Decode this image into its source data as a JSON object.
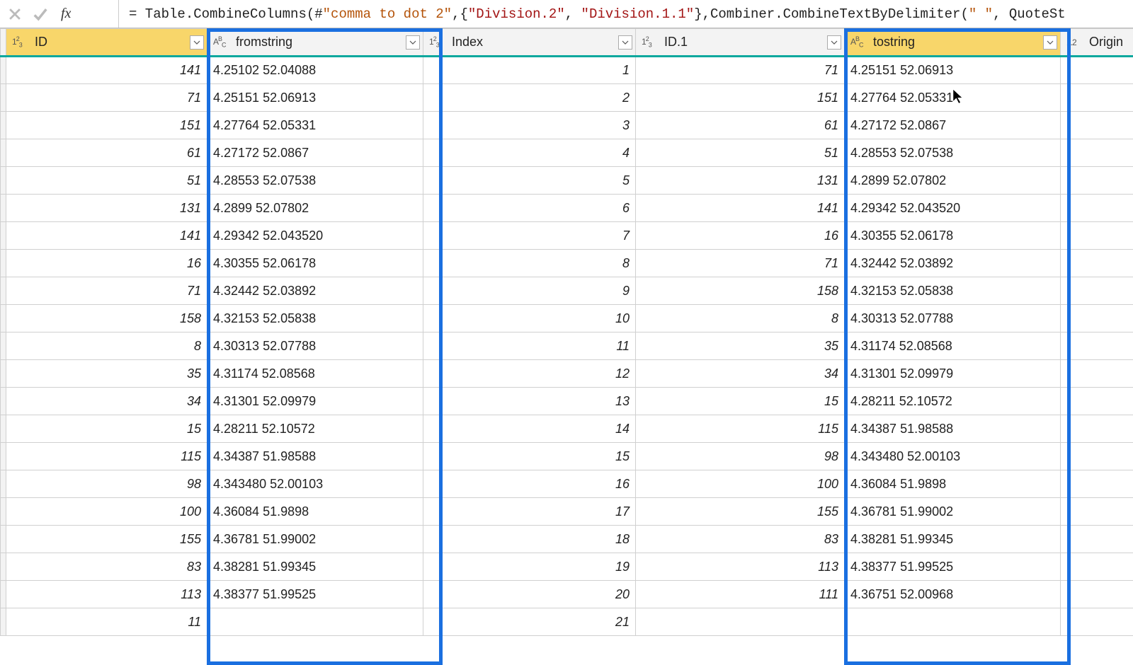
{
  "formula": {
    "prefix": "= Table.CombineColumns(#",
    "step_name": "\"comma to dot 2\"",
    "mid1": ",{",
    "col1": "\"Division.2\"",
    "sep": ", ",
    "col2": "\"Division.1.1\"",
    "mid2": "},Combiner.CombineTextByDelimiter(",
    "delim": "\" \"",
    "tail": ", QuoteSt"
  },
  "fx_label": "fx",
  "columns": {
    "id": {
      "label": "ID",
      "type": "123"
    },
    "from": {
      "label": "fromstring",
      "type": "ABC"
    },
    "index": {
      "label": "Index",
      "type": "123"
    },
    "id1": {
      "label": "ID.1",
      "type": "123"
    },
    "to": {
      "label": "tostring",
      "type": "ABC"
    },
    "origin": {
      "label": "Origin",
      "type": "1.2"
    }
  },
  "rows": [
    {
      "id": "141",
      "from": "4.25102 52.04088",
      "index": "1",
      "id1": "71",
      "to": "4.25151 52.06913"
    },
    {
      "id": "71",
      "from": "4.25151 52.06913",
      "index": "2",
      "id1": "151",
      "to": "4.27764 52.05331"
    },
    {
      "id": "151",
      "from": "4.27764 52.05331",
      "index": "3",
      "id1": "61",
      "to": "4.27172 52.0867"
    },
    {
      "id": "61",
      "from": "4.27172 52.0867",
      "index": "4",
      "id1": "51",
      "to": "4.28553 52.07538"
    },
    {
      "id": "51",
      "from": "4.28553 52.07538",
      "index": "5",
      "id1": "131",
      "to": "4.2899 52.07802"
    },
    {
      "id": "131",
      "from": "4.2899 52.07802",
      "index": "6",
      "id1": "141",
      "to": "4.29342 52.043520"
    },
    {
      "id": "141",
      "from": "4.29342 52.043520",
      "index": "7",
      "id1": "16",
      "to": "4.30355 52.06178"
    },
    {
      "id": "16",
      "from": "4.30355 52.06178",
      "index": "8",
      "id1": "71",
      "to": "4.32442 52.03892"
    },
    {
      "id": "71",
      "from": "4.32442 52.03892",
      "index": "9",
      "id1": "158",
      "to": "4.32153 52.05838"
    },
    {
      "id": "158",
      "from": "4.32153 52.05838",
      "index": "10",
      "id1": "8",
      "to": "4.30313 52.07788"
    },
    {
      "id": "8",
      "from": "4.30313 52.07788",
      "index": "11",
      "id1": "35",
      "to": "4.31174 52.08568"
    },
    {
      "id": "35",
      "from": "4.31174 52.08568",
      "index": "12",
      "id1": "34",
      "to": "4.31301 52.09979"
    },
    {
      "id": "34",
      "from": "4.31301 52.09979",
      "index": "13",
      "id1": "15",
      "to": "4.28211 52.10572"
    },
    {
      "id": "15",
      "from": "4.28211 52.10572",
      "index": "14",
      "id1": "115",
      "to": "4.34387 51.98588"
    },
    {
      "id": "115",
      "from": "4.34387 51.98588",
      "index": "15",
      "id1": "98",
      "to": "4.343480 52.00103"
    },
    {
      "id": "98",
      "from": "4.343480 52.00103",
      "index": "16",
      "id1": "100",
      "to": "4.36084 51.9898"
    },
    {
      "id": "100",
      "from": "4.36084 51.9898",
      "index": "17",
      "id1": "155",
      "to": "4.36781 51.99002"
    },
    {
      "id": "155",
      "from": "4.36781 51.99002",
      "index": "18",
      "id1": "83",
      "to": "4.38281 51.99345"
    },
    {
      "id": "83",
      "from": "4.38281 51.99345",
      "index": "19",
      "id1": "113",
      "to": "4.38377 51.99525"
    },
    {
      "id": "113",
      "from": "4.38377 51.99525",
      "index": "20",
      "id1": "111",
      "to": "4.36751 52.00968"
    },
    {
      "id": "11",
      "from": "",
      "index": "21",
      "id1": "",
      "to": ""
    }
  ]
}
